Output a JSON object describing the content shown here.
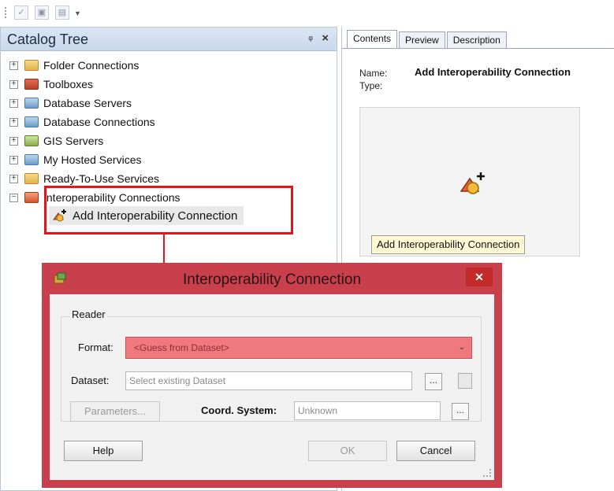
{
  "toolbar": {
    "buttons": [
      "check-icon",
      "view-icon",
      "dock-icon"
    ]
  },
  "catalog": {
    "title": "Catalog Tree",
    "pin_glyph": "↕",
    "close_glyph": "×",
    "items": [
      {
        "label": "Folder Connections",
        "expander": "+",
        "icon": "folder-icon",
        "color": "#e3b44a"
      },
      {
        "label": "Toolboxes",
        "expander": "+",
        "icon": "toolbox-icon",
        "color": "#b6402c"
      },
      {
        "label": "Database Servers",
        "expander": "+",
        "icon": "database-server-icon",
        "color": "#6d9ccb"
      },
      {
        "label": "Database Connections",
        "expander": "+",
        "icon": "database-connection-icon",
        "color": "#6d9ccb"
      },
      {
        "label": "GIS Servers",
        "expander": "+",
        "icon": "gis-server-icon",
        "color": "#8bb04b"
      },
      {
        "label": "My Hosted Services",
        "expander": "+",
        "icon": "hosted-services-icon",
        "color": "#6d9ccb"
      },
      {
        "label": "Ready-To-Use Services",
        "expander": "+",
        "icon": "ready-services-icon",
        "color": "#e3b44a"
      },
      {
        "label": "Interoperability Connections",
        "expander": "−",
        "icon": "interop-folder-icon",
        "color": "#d4552f"
      }
    ],
    "sub_item": {
      "label": "Add Interoperability Connection",
      "icon": "add-interop-connection-icon"
    }
  },
  "right_panel": {
    "tabs": [
      "Contents",
      "Preview",
      "Description"
    ],
    "active_tab": "Contents",
    "name_label": "Name:",
    "type_label": "Type:",
    "name_value": "Add Interoperability Connection",
    "preview_label": "Add Interoperability Connection"
  },
  "dialog": {
    "title": "Interoperability Connection",
    "close_glyph": "✕",
    "group_label": "Reader",
    "format_label": "Format:",
    "format_value": "<Guess from Dataset>",
    "dataset_label": "Dataset:",
    "dataset_placeholder": "Select existing  Dataset",
    "parameters_label": "Parameters...",
    "coord_label": "Coord. System:",
    "coord_value": "Unknown",
    "dots": "...",
    "help": "Help",
    "ok": "OK",
    "cancel": "Cancel"
  },
  "colors": {
    "annotation_red": "#e0161b",
    "dialog_frame": "#c8404c",
    "format_highlight": "#f0787f"
  }
}
